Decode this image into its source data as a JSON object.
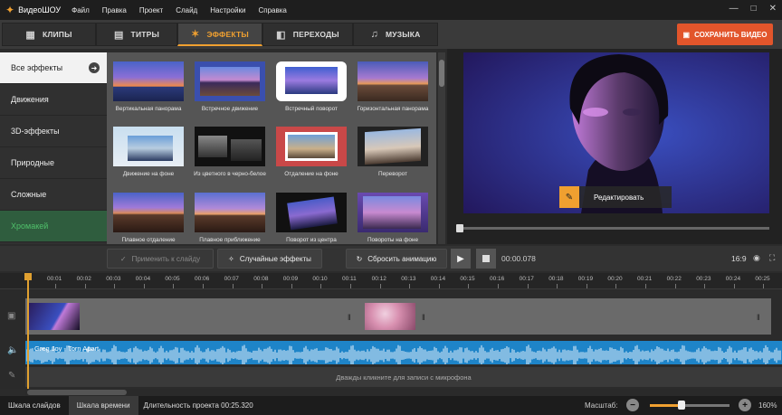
{
  "app": {
    "brand": "ВидеоШОУ"
  },
  "menu": [
    "Файл",
    "Правка",
    "Проект",
    "Слайд",
    "Настройки",
    "Справка"
  ],
  "window_controls": [
    "—",
    "□",
    "✕"
  ],
  "tabs": [
    {
      "label": "КЛИПЫ",
      "icon": "film-icon"
    },
    {
      "label": "ТИТРЫ",
      "icon": "titles-icon"
    },
    {
      "label": "ЭФФЕКТЫ",
      "icon": "effects-icon",
      "active": true
    },
    {
      "label": "ПЕРЕХОДЫ",
      "icon": "transitions-icon"
    },
    {
      "label": "МУЗЫКА",
      "icon": "music-icon"
    }
  ],
  "save_button": "СОХРАНИТЬ ВИДЕО",
  "categories": [
    {
      "label": "Все эффекты",
      "active": true
    },
    {
      "label": "Движения"
    },
    {
      "label": "3D-эффекты"
    },
    {
      "label": "Природные"
    },
    {
      "label": "Сложные"
    },
    {
      "label": "Хромакей",
      "highlight": true
    }
  ],
  "effects": [
    "Вертикальная панорама",
    "Встречное движение",
    "Встречный поворот",
    "Горизонтальная панорама",
    "Движение на фоне",
    "Из цветного в черно-белое",
    "Отдаление на фоне",
    "Переворот",
    "Плавное отдаление",
    "Плавное приближение",
    "Поворот из центра",
    "Повороты на фоне"
  ],
  "preview": {
    "edit_button": "Редактировать"
  },
  "controls": {
    "apply_to_slide": "Применить к слайду",
    "random_effects": "Случайные эффекты",
    "reset_animation": "Сбросить анимацию",
    "timecode": "00:00.078",
    "ratio": "16:9"
  },
  "ruler_ticks": [
    "00:01",
    "00:02",
    "00:03",
    "00:04",
    "00:05",
    "00:06",
    "00:07",
    "00:08",
    "00:09",
    "00:10",
    "00:11",
    "00:12",
    "00:13",
    "00:14",
    "00:15",
    "00:16",
    "00:17",
    "00:18",
    "00:19",
    "00:20",
    "00:21",
    "00:22",
    "00:23",
    "00:24",
    "00:25"
  ],
  "audio": {
    "track_name": "Greg Joy - Torn Apart"
  },
  "mic_hint": "Дважды кликните для записи с микрофона",
  "status": {
    "tab_slides": "Шкала слайдов",
    "tab_timeline": "Шкала времени",
    "duration": "Длительность проекта 00:25.320",
    "zoom_label": "Масштаб:",
    "zoom_percent": "160%",
    "zoom_level": 0.4
  },
  "colors": {
    "accent": "#f0a030",
    "save": "#e2552b",
    "audio": "#1e84c8",
    "chromakey": "#4fc06a"
  }
}
